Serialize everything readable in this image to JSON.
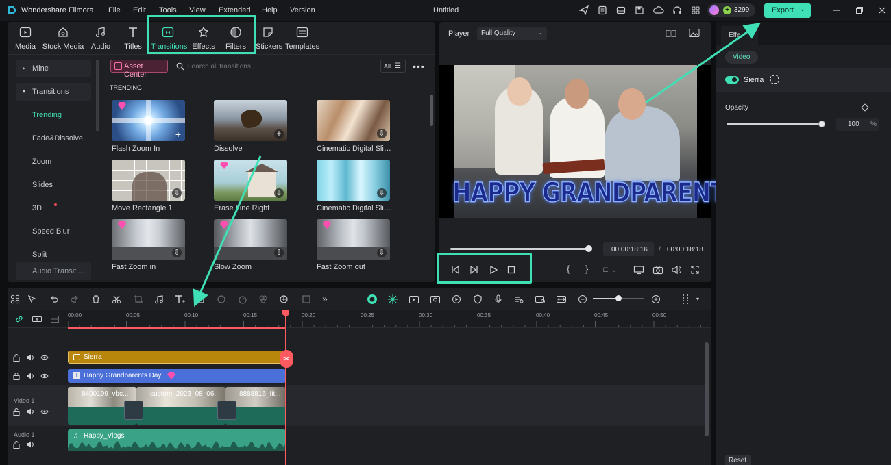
{
  "app": {
    "name": "Wondershare Filmora",
    "project_title": "Untitled",
    "credits": "3299",
    "export_label": "Export"
  },
  "menu": [
    "File",
    "Edit",
    "Tools",
    "View",
    "Extended",
    "Help",
    "Version"
  ],
  "media_tabs": [
    {
      "label": "Media",
      "icon": "media-icon"
    },
    {
      "label": "Stock Media",
      "icon": "stock-media-icon"
    },
    {
      "label": "Audio",
      "icon": "audio-icon"
    },
    {
      "label": "Titles",
      "icon": "titles-icon"
    },
    {
      "label": "Transitions",
      "icon": "transitions-icon",
      "active": true
    },
    {
      "label": "Effects",
      "icon": "effects-icon"
    },
    {
      "label": "Filters",
      "icon": "filters-icon"
    },
    {
      "label": "Stickers",
      "icon": "stickers-icon"
    },
    {
      "label": "Templates",
      "icon": "templates-icon"
    }
  ],
  "sidebar": {
    "items": [
      {
        "label": "Mine"
      },
      {
        "label": "Transitions"
      },
      {
        "label": "Trending",
        "active": true
      },
      {
        "label": "Fade&Dissolve"
      },
      {
        "label": "Zoom"
      },
      {
        "label": "Slides"
      },
      {
        "label": "3D"
      },
      {
        "label": "Speed Blur"
      },
      {
        "label": "Split"
      },
      {
        "label": "Audio Transiti..."
      }
    ]
  },
  "browser": {
    "asset_center": "Asset Center",
    "search_placeholder": "Search all transitions",
    "filter_label": "All",
    "section": "TRENDING",
    "items": [
      {
        "label": "Flash Zoom In",
        "premium": true
      },
      {
        "label": "Dissolve",
        "premium": false
      },
      {
        "label": "Cinematic Digital Slide...",
        "premium": false
      },
      {
        "label": "Move Rectangle 1",
        "premium": false
      },
      {
        "label": "Erase Line Right",
        "premium": true
      },
      {
        "label": "Cinematic Digital Slide...",
        "premium": false
      },
      {
        "label": "Fast Zoom in",
        "premium": true
      },
      {
        "label": "Slow Zoom",
        "premium": true
      },
      {
        "label": "Fast Zoom out",
        "premium": true
      }
    ]
  },
  "player": {
    "label": "Player",
    "quality": "Full Quality",
    "overlay_text": "HAPPY GRANDPARENTS DAY",
    "current_time": "00:00:18:16",
    "separator": "/",
    "total_time": "00:00:18:18",
    "progress": 1.0
  },
  "right_panel": {
    "tab": "Effe",
    "sub_tab": "Video",
    "effect_name": "Sierra",
    "opacity_label": "Opacity",
    "opacity_value": "100",
    "opacity_unit": "%",
    "reset_label": "Reset"
  },
  "timeline": {
    "ruler": [
      "00:00",
      "00:05",
      "00:10",
      "00:15",
      "00:20",
      "00:25",
      "00:30",
      "00:35",
      "00:40",
      "00:45",
      "00:50"
    ],
    "tracks": {
      "video1": "Video 1",
      "audio1": "Audio 1"
    },
    "clips": {
      "effect": "Sierra",
      "title": "Happy Grandparents Day",
      "video_a": "8400199_vbc...",
      "video_b": "custom_2023_08_06...",
      "video_c": "8888816_fit...",
      "audio": "Happy_Vlogs"
    }
  },
  "colors": {
    "accent": "#3fe0b5",
    "effect_clip": "#b8860b",
    "title_clip": "#4a6fd8",
    "video_clip": "#1f6b5a",
    "audio_clip": "#3aa387",
    "playhead": "#ff5a5f"
  }
}
